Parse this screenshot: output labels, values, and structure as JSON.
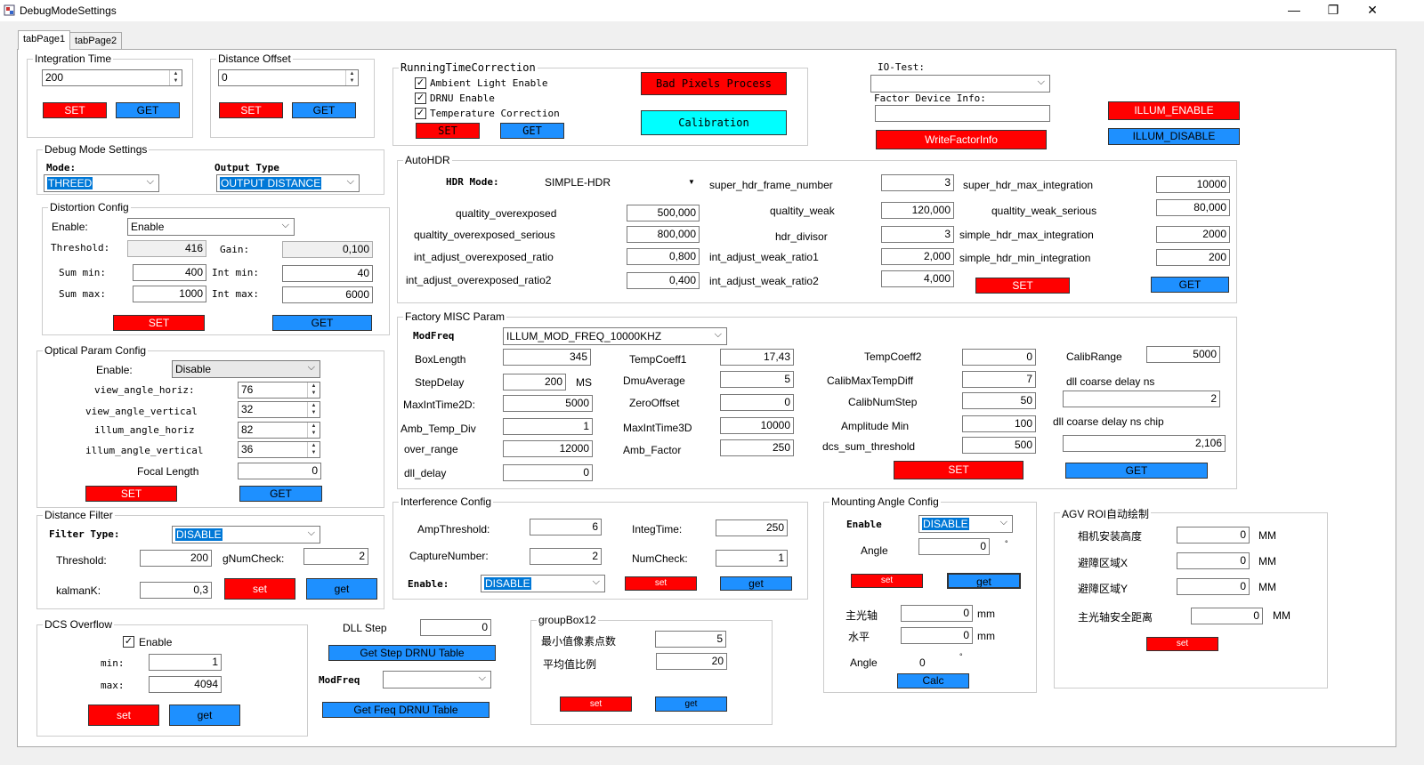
{
  "window": {
    "title": "DebugModeSettings",
    "min": "—",
    "max": "❐",
    "close": "✕"
  },
  "tabs": [
    "tabPage1",
    "tabPage2"
  ],
  "integration": {
    "title": "Integration Time",
    "value": "200",
    "set": "SET",
    "get": "GET"
  },
  "distance_offset": {
    "title": "Distance Offset",
    "value": "0",
    "set": "SET",
    "get": "GET"
  },
  "rtc": {
    "title": "RunningTimeCorrection",
    "ambient": "Ambient Light Enable",
    "drnu": "DRNU Enable",
    "temp": "Temperature Correction",
    "set": "SET",
    "get": "GET",
    "bad_pixels": "Bad Pixels Process",
    "calibration": "Calibration"
  },
  "io": {
    "title": "IO-Test:",
    "factor_info": "Factor Device Info:",
    "write": "WriteFactorInfo",
    "illum_enable": "ILLUM_ENABLE",
    "illum_disable": "ILLUM_DISABLE"
  },
  "debug_mode": {
    "title": "Debug Mode Settings",
    "mode_label": "Mode:",
    "mode_value": "THREED",
    "output_label": "Output Type",
    "output_value": "OUTPUT DISTANCE"
  },
  "distortion": {
    "title": "Distortion Config",
    "enable_label": "Enable:",
    "enable_value": "Enable",
    "threshold_label": "Threshold:",
    "threshold": "416",
    "gain_label": "Gain:",
    "gain": "0,100",
    "summin_label": "Sum min:",
    "summin": "400",
    "intmin_label": "Int min:",
    "intmin": "40",
    "summax_label": "Sum max:",
    "summax": "1000",
    "intmax_label": "Int max:",
    "intmax": "6000",
    "set": "SET",
    "get": "GET"
  },
  "optical": {
    "title": "Optical Param Config",
    "enable_label": "Enable:",
    "enable_value": "Disable",
    "vah_label": "view_angle_horiz:",
    "vah": "76",
    "vav_label": "view_angle_vertical",
    "vav": "32",
    "iah_label": "illum_angle_horiz",
    "iah": "82",
    "iav_label": "illum_angle_vertical",
    "iav": "36",
    "focal_label": "Focal Length",
    "focal": "0",
    "set": "SET",
    "get": "GET"
  },
  "distance_filter": {
    "title": "Distance Filter",
    "type_label": "Filter Type:",
    "type_value": "DISABLE",
    "threshold_label": "Threshold:",
    "threshold": "200",
    "gnum_label": "gNumCheck:",
    "gnum": "2",
    "kalman_label": "kalmanK:",
    "kalman": "0,3",
    "set": "set",
    "get": "get"
  },
  "dcs": {
    "title": "DCS Overflow",
    "enable": "Enable",
    "min_label": "min:",
    "min": "1",
    "max_label": "max:",
    "max": "4094",
    "set": "set",
    "get": "get"
  },
  "dll": {
    "step_label": "DLL Step",
    "step": "0",
    "get_step": "Get Step DRNU Table",
    "modfreq_label": "ModFreq",
    "get_freq": "Get Freq DRNU Table"
  },
  "autohdr": {
    "title": "AutoHDR",
    "mode_label": "HDR Mode:",
    "mode_value": "SIMPLE-HDR",
    "fields": {
      "super_hdr_frame_number": "3",
      "super_hdr_max_integration": "10000",
      "qualtity_overexposed": "500,000",
      "qualtity_weak": "120,000",
      "qualtity_weak_serious": "80,000",
      "qualtity_overexposed_serious": "800,000",
      "hdr_divisor": "3",
      "simple_hdr_max_integration": "2000",
      "int_adjust_overexposed_ratio": "0,800",
      "int_adjust_weak_ratio1": "2,000",
      "simple_hdr_min_integration": "200",
      "int_adjust_overexposed_ratio2": "0,400",
      "int_adjust_weak_ratio2": "4,000"
    },
    "labels": {
      "super_hdr_frame_number": "super_hdr_frame_number",
      "super_hdr_max_integration": "super_hdr_max_integration",
      "qualtity_overexposed": "qualtity_overexposed",
      "qualtity_weak": "qualtity_weak",
      "qualtity_weak_serious": "qualtity_weak_serious",
      "qualtity_overexposed_serious": "qualtity_overexposed_serious",
      "hdr_divisor": "hdr_divisor",
      "simple_hdr_max_integration": "simple_hdr_max_integration",
      "int_adjust_overexposed_ratio": "int_adjust_overexposed_ratio",
      "int_adjust_weak_ratio1": "int_adjust_weak_ratio1",
      "simple_hdr_min_integration": "simple_hdr_min_integration",
      "int_adjust_overexposed_ratio2": "int_adjust_overexposed_ratio2",
      "int_adjust_weak_ratio2": "int_adjust_weak_ratio2"
    },
    "set": "SET",
    "get": "GET"
  },
  "factory": {
    "title": "Factory MISC Param",
    "modfreq_label": "ModFreq",
    "modfreq": "ILLUM_MOD_FREQ_10000KHZ",
    "labels": {
      "BoxLength": "BoxLength",
      "StepDelay": "StepDelay",
      "ms": "MS",
      "MaxIntTime2D": "MaxIntTime2D:",
      "Amb_Temp_Div": "Amb_Temp_Div",
      "over_range": "over_range",
      "dll_delay": "dll_delay",
      "TempCoeff1": "TempCoeff1",
      "DmuAverage": "DmuAverage",
      "ZeroOffset": "ZeroOffset",
      "MaxIntTime3D": "MaxIntTime3D",
      "Amb_Factor": "Amb_Factor",
      "TempCoeff2": "TempCoeff2",
      "CalibMaxTempDiff": "CalibMaxTempDiff",
      "CalibNumStep": "CalibNumStep",
      "AmplitudeMin": "Amplitude Min",
      "dcs_sum_threshold": "dcs_sum_threshold",
      "CalibRange": "CalibRange",
      "dll_coarse": "dll coarse delay ns",
      "dll_coarse_chip": "dll coarse delay ns chip"
    },
    "values": {
      "BoxLength": "345",
      "StepDelay": "200",
      "MaxIntTime2D": "5000",
      "Amb_Temp_Div": "1",
      "over_range": "12000",
      "dll_delay": "0",
      "TempCoeff1": "17,43",
      "DmuAverage": "5",
      "ZeroOffset": "0",
      "MaxIntTime3D": "10000",
      "Amb_Factor": "250",
      "TempCoeff2": "0",
      "CalibMaxTempDiff": "7",
      "CalibNumStep": "50",
      "AmplitudeMin": "100",
      "dcs_sum_threshold": "500",
      "CalibRange": "5000",
      "dll_coarse": "2",
      "dll_coarse_chip": "2,106"
    },
    "set": "SET",
    "get": "GET"
  },
  "interference": {
    "title": "Interference Config",
    "amp_label": "AmpThreshold:",
    "amp": "6",
    "integ_label": "IntegTime:",
    "integ": "250",
    "capture_label": "CaptureNumber:",
    "capture": "2",
    "numcheck_label": "NumCheck:",
    "numcheck": "1",
    "enable_label": "Enable:",
    "enable_value": "DISABLE",
    "set": "set",
    "get": "get"
  },
  "groupbox12": {
    "title": "groupBox12",
    "min_label": "最小值像素点数",
    "min": "5",
    "avg_label": "平均值比例",
    "avg": "20",
    "set": "set",
    "get": "get"
  },
  "mounting": {
    "title": "Mounting Angle Config",
    "enable_label": "Enable",
    "enable_value": "DISABLE",
    "angle_label": "Angle",
    "angle": "0",
    "deg": "°",
    "set": "set",
    "get": "get",
    "main_label": "主光轴",
    "main": "0",
    "horiz_label": "水平",
    "horiz": "0",
    "mm": "mm",
    "angle2_label": "Angle",
    "angle2": "0",
    "calc": "Calc"
  },
  "agv": {
    "title": "AGV ROI自动绘制",
    "h_label": "相机安装高度",
    "h": "0",
    "x_label": "避障区域X",
    "x": "0",
    "y_label": "避障区域Y",
    "y": "0",
    "safe_label": "主光轴安全距离",
    "safe": "0",
    "unit": "MM",
    "set": "set"
  }
}
